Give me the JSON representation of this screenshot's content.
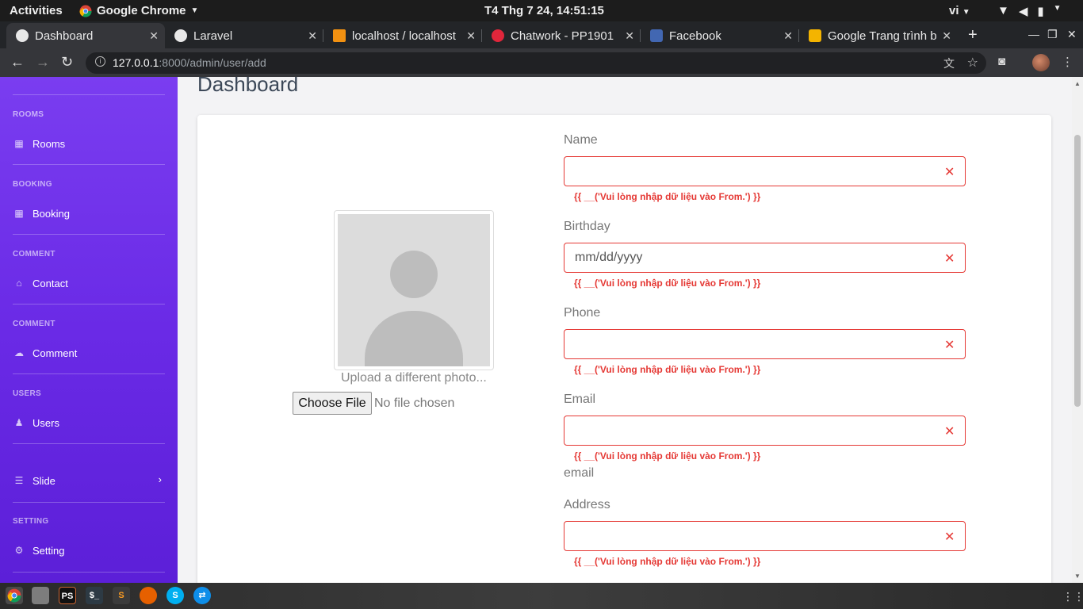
{
  "system_bar": {
    "activities": "Activities",
    "app_menu": "Google Chrome",
    "clock": "T4 Thg 7 24, 14:51:15",
    "language": "vi"
  },
  "browser": {
    "tabs": [
      {
        "title": "Dashboard",
        "active": true,
        "favicon_color": "#e8e8e8"
      },
      {
        "title": "Laravel",
        "active": false,
        "favicon_color": "#e8e8e8"
      },
      {
        "title": "localhost / localhost",
        "active": false,
        "favicon_color": "#f29111"
      },
      {
        "title": "Chatwork - PP1901",
        "active": false,
        "favicon_color": "#e0263b"
      },
      {
        "title": "Facebook",
        "active": false,
        "favicon_color": "#4267b2"
      },
      {
        "title": "Google Trang trình b",
        "active": false,
        "favicon_color": "#f4b400"
      }
    ],
    "url_host": "127.0.0.1",
    "url_path": ":8000/admin/user/add"
  },
  "sidebar": {
    "sections": [
      {
        "heading": "ROOMS",
        "item": "Rooms",
        "icon": "table-icon"
      },
      {
        "heading": "BOOKING",
        "item": "Booking",
        "icon": "table-icon"
      },
      {
        "heading": "COMMENT",
        "item": "Contact",
        "icon": "inbox-icon"
      },
      {
        "heading": "COMMENT",
        "item": "Comment",
        "icon": "comments-icon"
      },
      {
        "heading": "USERS",
        "item": "Users",
        "icon": "users-icon"
      },
      {
        "heading": "",
        "item": "Slide",
        "icon": "sliders-icon"
      },
      {
        "heading": "SETTING",
        "item": "Setting",
        "icon": "cogs-icon"
      }
    ]
  },
  "main": {
    "page_title": "Dashboard",
    "photo": {
      "upload_text": "Upload a different photo...",
      "choose_button": "Choose File",
      "no_file": "No file chosen"
    },
    "form": {
      "name_label": "Name",
      "birthday_label": "Birthday",
      "birthday_placeholder": "mm/dd/yyyy",
      "phone_label": "Phone",
      "email_label": "Email",
      "email_extra": "email",
      "address_label": "Address",
      "error_text": "{{ __('Vui lòng nhập dữ liệu vào From.') }}",
      "clear_mark": "✕"
    }
  },
  "dock": {
    "apps": [
      "chrome-icon",
      "files-icon",
      "phpstorm-icon",
      "terminal-icon",
      "sublime-icon",
      "firefox-icon",
      "skype-icon",
      "teamviewer-icon"
    ]
  }
}
